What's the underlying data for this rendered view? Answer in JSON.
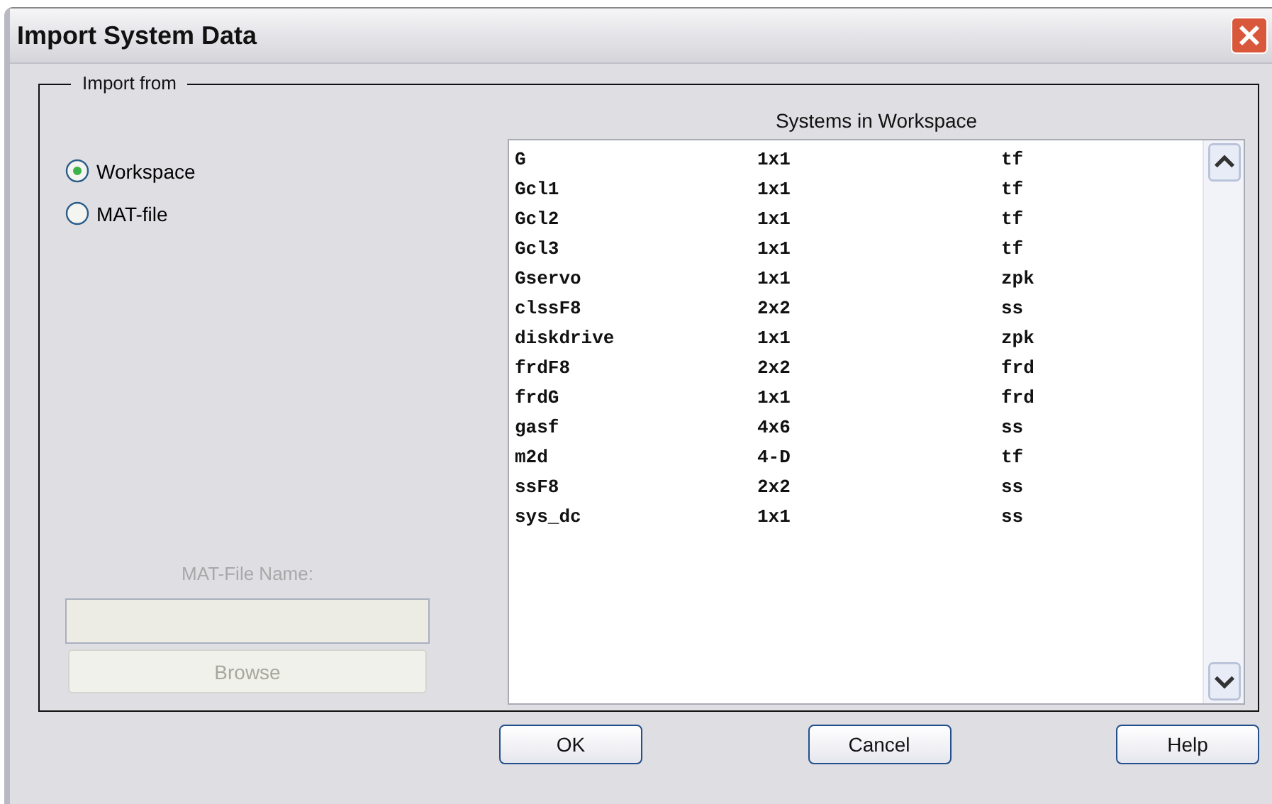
{
  "window": {
    "title": "Import System Data"
  },
  "import_from": {
    "legend": "Import from",
    "options": [
      {
        "label": "Workspace",
        "selected": true
      },
      {
        "label": "MAT-file",
        "selected": false
      }
    ],
    "mat_file": {
      "label": "MAT-File Name:",
      "disabled": true,
      "browse": "Browse"
    }
  },
  "systems": {
    "heading": "Systems in Workspace",
    "rows": [
      {
        "name": "G",
        "size": "1x1",
        "type": "tf"
      },
      {
        "name": "Gcl1",
        "size": "1x1",
        "type": "tf"
      },
      {
        "name": "Gcl2",
        "size": "1x1",
        "type": "tf"
      },
      {
        "name": "Gcl3",
        "size": "1x1",
        "type": "tf"
      },
      {
        "name": "Gservo",
        "size": "1x1",
        "type": "zpk"
      },
      {
        "name": "clssF8",
        "size": "2x2",
        "type": "ss"
      },
      {
        "name": "diskdrive",
        "size": "1x1",
        "type": "zpk"
      },
      {
        "name": "frdF8",
        "size": "2x2",
        "type": "frd"
      },
      {
        "name": "frdG",
        "size": "1x1",
        "type": "frd"
      },
      {
        "name": "gasf",
        "size": "4x6",
        "type": "ss"
      },
      {
        "name": "m2d",
        "size": "4-D",
        "type": "tf"
      },
      {
        "name": "ssF8",
        "size": "2x2",
        "type": "ss"
      },
      {
        "name": "sys_dc",
        "size": "1x1",
        "type": "ss"
      }
    ]
  },
  "buttons": [
    "OK",
    "Cancel",
    "Help"
  ]
}
